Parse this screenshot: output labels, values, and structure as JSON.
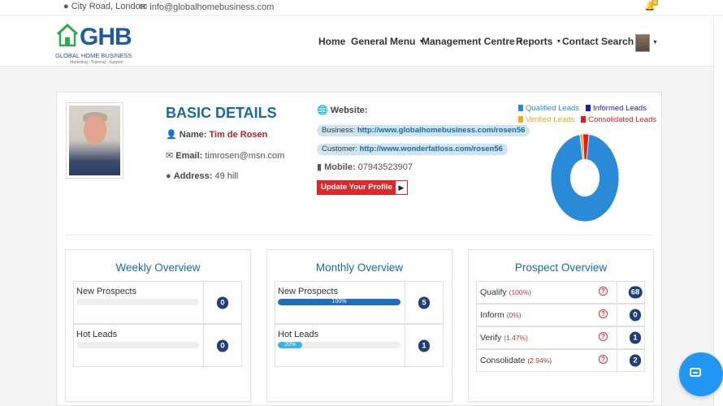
{
  "topbar": {
    "location": "City Road, London",
    "email": "info@globalhomebusiness.com",
    "notification_count": "4"
  },
  "brand": {
    "logo": "GHB",
    "name": "GLOBAL HOME BUSINESS",
    "tagline": "Marketing . Training . Support"
  },
  "nav": {
    "items": [
      {
        "label": "Home"
      },
      {
        "label": "General Menu"
      },
      {
        "label": "Management Centre"
      },
      {
        "label": "Reports"
      },
      {
        "label": "Contact Search"
      }
    ]
  },
  "basic": {
    "title": "BASIC DETAILS",
    "name_label": "Name:",
    "name_value": "Tim de Rosen",
    "email_label": "Email:",
    "email_value": "timrosen@msn.com",
    "address_label": "Address:",
    "address_value": "49 hill"
  },
  "website": {
    "label": "Website:",
    "business_label": "Business:",
    "business_url": "http://www.globalhomebusiness.com/rosen56",
    "customer_label": "Customer:",
    "customer_url": "http://www.wonderfatloss.com/rosen56",
    "mobile_label": "Mobile:",
    "mobile_value": "07943523907",
    "update_button": "Update Your Profile"
  },
  "chart_data": {
    "type": "pie",
    "categories": [
      "Qualified Leads",
      "Informed Leads",
      "Verified Leads",
      "Consolidated Leads"
    ],
    "values": [
      68,
      0,
      1,
      2
    ],
    "colors": [
      "#2a8bd8",
      "#1a1acc",
      "#f5a623",
      "#e02020"
    ],
    "legend": "top"
  },
  "weekly": {
    "title": "Weekly Overview",
    "rows": [
      {
        "label": "New Prospects",
        "percent": 0,
        "percent_label": "",
        "count": "0"
      },
      {
        "label": "Hot Leads",
        "percent": 0,
        "percent_label": "",
        "count": "0"
      }
    ]
  },
  "monthly": {
    "title": "Monthly Overview",
    "rows": [
      {
        "label": "New Prospects",
        "percent": 100,
        "percent_label": "100%",
        "count": "5"
      },
      {
        "label": "Hot Leads",
        "percent": 20,
        "percent_label": "20%",
        "count": "1"
      }
    ]
  },
  "prospect": {
    "title": "Prospect Overview",
    "rows": [
      {
        "label": "Qualify",
        "pct": "(100%)",
        "count": "68"
      },
      {
        "label": "Inform",
        "pct": "(0%)",
        "count": "0"
      },
      {
        "label": "Verify",
        "pct": "(1.47%)",
        "count": "1"
      },
      {
        "label": "Consolidate",
        "pct": "(2.94%)",
        "count": "2"
      }
    ]
  },
  "icons": {
    "location": "map-marker-icon",
    "email": "envelope-icon",
    "bell": "bell-icon",
    "help": "question-circle-icon",
    "chat": "chat-icon"
  }
}
